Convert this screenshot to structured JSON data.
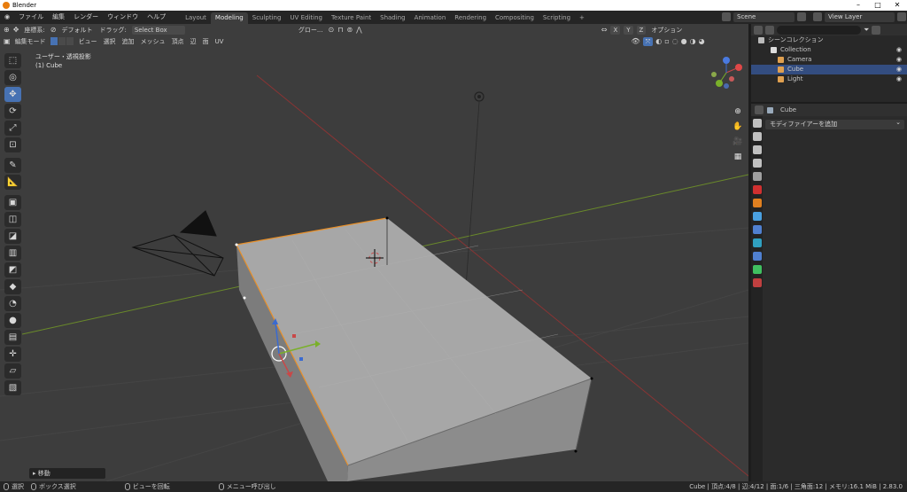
{
  "window": {
    "title": "Blender",
    "minimize": "–",
    "maximize": "□",
    "close": "✕"
  },
  "menus": [
    "ファイル",
    "編集",
    "レンダー",
    "ウィンドウ",
    "ヘルプ"
  ],
  "workspaces": [
    "Layout",
    "Modeling",
    "Sculpting",
    "UV Editing",
    "Texture Paint",
    "Shading",
    "Animation",
    "Rendering",
    "Compositing",
    "Scripting"
  ],
  "active_workspace": "Modeling",
  "add_tab": "+",
  "scene": {
    "label": "Scene"
  },
  "view_layer": {
    "label": "View Layer"
  },
  "viewport": {
    "header1": {
      "coord_label": "座標系:",
      "orientation": "デフォルト",
      "drag_label": "ドラッグ:",
      "select_mode": "Select Box",
      "transform": "グロー...",
      "options": "オプション",
      "axis_x": "X",
      "axis_y": "Y",
      "axis_z": "Z"
    },
    "header2": {
      "mode": "編集モード",
      "menus": [
        "ビュー",
        "選択",
        "追加",
        "メッシュ",
        "頂点",
        "辺",
        "面",
        "UV"
      ]
    },
    "view_name": "ユーザー・透視投影",
    "object_name": "(1) Cube",
    "operator_panel": "▸ 移動"
  },
  "tools": [
    {
      "name": "select-box-tool",
      "glyph": "⬚",
      "active": false
    },
    {
      "name": "cursor-tool",
      "glyph": "◎",
      "active": false
    },
    {
      "name": "move-tool",
      "glyph": "✥",
      "active": true
    },
    {
      "name": "rotate-tool",
      "glyph": "⟳",
      "active": false
    },
    {
      "name": "scale-tool",
      "glyph": "⤢",
      "active": false
    },
    {
      "name": "transform-tool",
      "glyph": "⊡",
      "active": false
    },
    {
      "name": "annotate-tool",
      "glyph": "✎",
      "active": false
    },
    {
      "name": "measure-tool",
      "glyph": "📐",
      "active": false
    },
    {
      "name": "extrude-tool",
      "glyph": "▣",
      "active": false
    },
    {
      "name": "inset-tool",
      "glyph": "◫",
      "active": false
    },
    {
      "name": "bevel-tool",
      "glyph": "◪",
      "active": false
    },
    {
      "name": "loop-cut-tool",
      "glyph": "▥",
      "active": false
    },
    {
      "name": "knife-tool",
      "glyph": "◩",
      "active": false
    },
    {
      "name": "poly-build-tool",
      "glyph": "◆",
      "active": false
    },
    {
      "name": "spin-tool",
      "glyph": "◔",
      "active": false
    },
    {
      "name": "smooth-tool",
      "glyph": "●",
      "active": false
    },
    {
      "name": "edge-slide-tool",
      "glyph": "▤",
      "active": false
    },
    {
      "name": "shrink-fatten-tool",
      "glyph": "✛",
      "active": false
    },
    {
      "name": "shear-tool",
      "glyph": "▱",
      "active": false
    },
    {
      "name": "rip-tool",
      "glyph": "▧",
      "active": false
    }
  ],
  "nav_icons": [
    "zoom-icon",
    "hand-icon",
    "camera-view-icon",
    "grid-view-icon"
  ],
  "outliner": {
    "search_placeholder": "",
    "root": "シーンコレクション",
    "collection": "Collection",
    "items": [
      {
        "name": "Camera",
        "color": "#e0a050",
        "selected": false
      },
      {
        "name": "Cube",
        "color": "#e0a050",
        "selected": true
      },
      {
        "name": "Light",
        "color": "#e0a050",
        "selected": false
      }
    ]
  },
  "properties": {
    "object": "Cube",
    "add_modifier": "モディファイアーを追加",
    "tab_colors": [
      "#c0c0c0",
      "#c0c0c0",
      "#c0c0c0",
      "#c0c0c0",
      "#a0a0a0",
      "#d03030",
      "#e08020",
      "#4aa0e0",
      "#5080d0",
      "#30a0c0",
      "#5080d0",
      "#40c060",
      "#c04040"
    ]
  },
  "status": {
    "select": "選択",
    "box_select": "ボックス選択",
    "rotate_view": "ビューを回転",
    "call_menu": "メニュー呼び出し",
    "stats": "Cube | 頂点:4/8 | 辺:4/12 | 面:1/6 | 三角面:12 | メモリ:16.1 MiB | 2.83.0"
  },
  "colors": {
    "accent": "#4772b3",
    "selection_orange": "#e8902a",
    "x_axis": "#c84848",
    "y_axis": "#7ab02a"
  }
}
